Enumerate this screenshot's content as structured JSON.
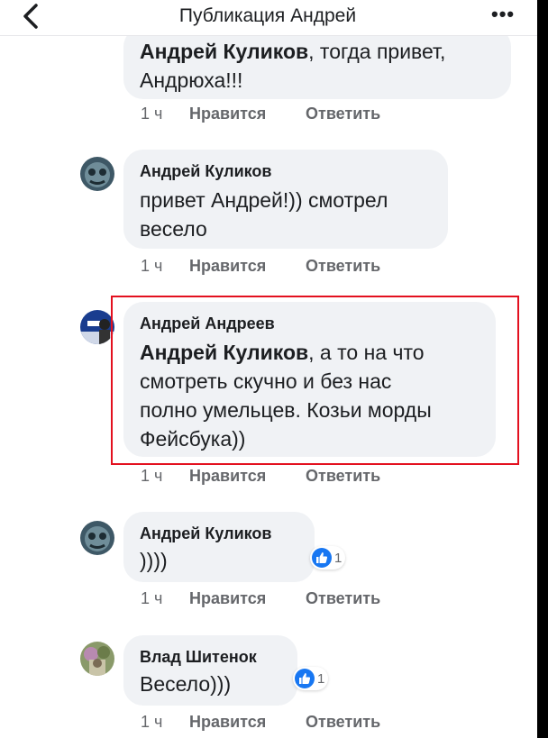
{
  "header": {
    "title": "Публикация Андрей",
    "more_label": "•••"
  },
  "comments": [
    {
      "author": "",
      "mention": "Андрей Куликов",
      "text_line1_rest": ", тогда привет,",
      "text_line2": "Андрюха!!!",
      "time": "1 ч",
      "like_label": "Нравится",
      "reply_label": "Ответить"
    },
    {
      "author": "Андрей Куликов",
      "text_line1": "привет Андрей!)) смотрел",
      "text_line2": "весело",
      "time": "1 ч",
      "like_label": "Нравится",
      "reply_label": "Ответить"
    },
    {
      "author": "Андрей Андреев",
      "mention": "Андрей Куликов",
      "text_line1_rest": ", а то на что",
      "text_line2": "смотреть скучно и без нас",
      "text_line3": "полно умельцев. Козьи морды",
      "text_line4": "Фейсбука))",
      "time": "1 ч",
      "like_label": "Нравится",
      "reply_label": "Ответить",
      "highlighted": true
    },
    {
      "author": "Андрей Куликов",
      "text_line1": "))))",
      "reaction_count": "1",
      "reaction_icon": "thumbs-up-icon",
      "time": "1 ч",
      "like_label": "Нравится",
      "reply_label": "Ответить"
    },
    {
      "author": "Влад Шитенок",
      "text_line1": "Весело)))",
      "reaction_count": "1",
      "reaction_icon": "thumbs-up-icon",
      "time": "1 ч",
      "like_label": "Нравится",
      "reply_label": "Ответить"
    }
  ],
  "colors": {
    "bubble": "#f0f2f5",
    "highlight": "#e3101f",
    "like_blue": "#1877f2",
    "meta_gray": "#65676b"
  }
}
